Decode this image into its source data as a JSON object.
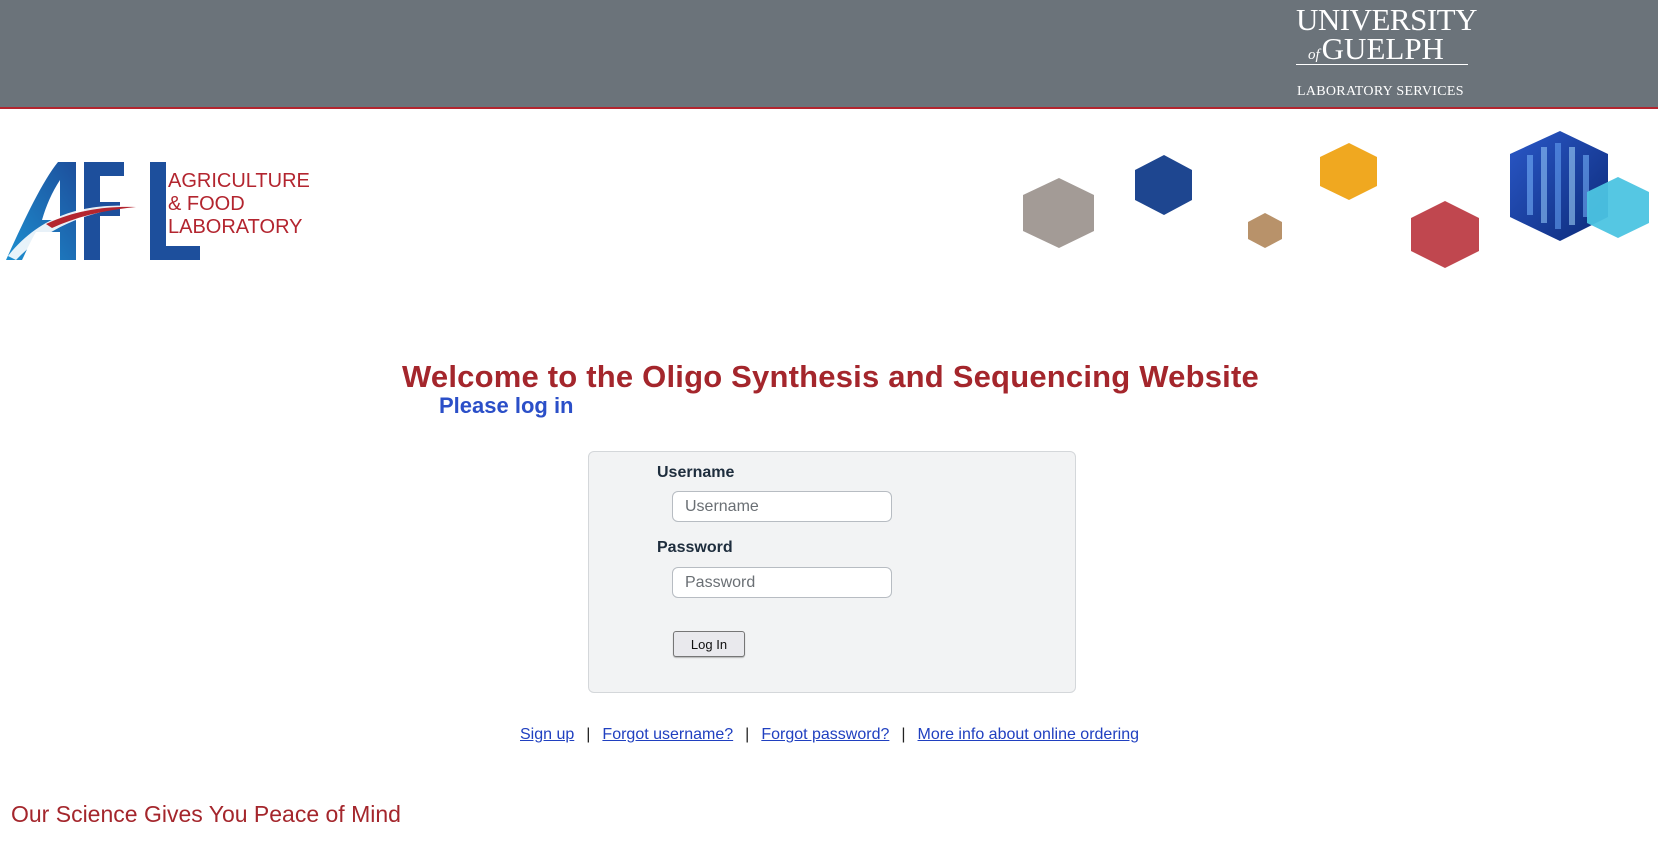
{
  "header": {
    "university_line1": "UNIVERSITY",
    "university_of": "of",
    "university_line2": "GUELPH",
    "department": "LABORATORY SERVICES"
  },
  "brand": {
    "logo_letters": "AFL",
    "logo_line1": "AGRICULTURE",
    "logo_line2": "& FOOD",
    "logo_line3": "LABORATORY"
  },
  "main": {
    "title": "Welcome to the Oligo Synthesis and Sequencing Website",
    "subtitle": "Please log in"
  },
  "login_form": {
    "username_label": "Username",
    "username_placeholder": "Username",
    "username_value": "",
    "password_label": "Password",
    "password_placeholder": "Password",
    "password_value": "",
    "submit_label": "Log In"
  },
  "links": {
    "sign_up": "Sign up",
    "forgot_username": "Forgot username?",
    "forgot_password": "Forgot password?",
    "more_info": "More info about online ordering",
    "separator": "|"
  },
  "footer": {
    "slogan": "Our Science Gives You Peace of Mind"
  },
  "colors": {
    "header_gray": "#6b737a",
    "brand_red": "#a4262c",
    "brand_blue": "#1d4f9c",
    "heading_blue": "#2b4fc8",
    "link_blue": "#2040c0",
    "hex_gray": "#a39b96",
    "hex_navy": "#1e4690",
    "hex_tan": "#b8926a",
    "hex_gold": "#f0a820",
    "hex_red": "#c0474f",
    "hex_sky": "#4cc4e2"
  }
}
